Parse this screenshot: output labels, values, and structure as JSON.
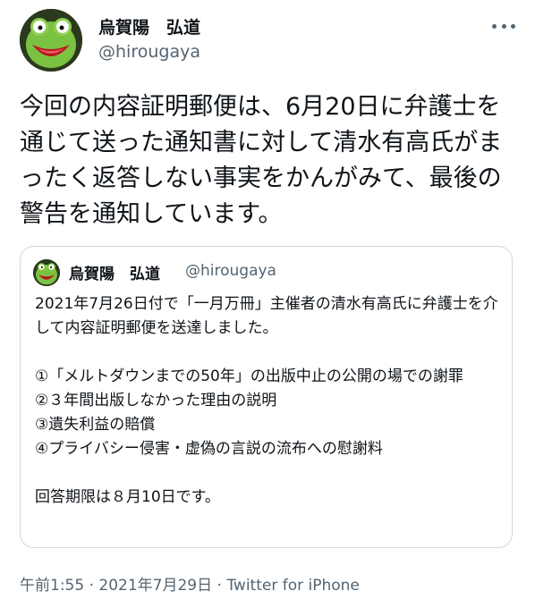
{
  "author": {
    "display_name": "烏賀陽　弘道",
    "handle": "@hirougaya"
  },
  "tweet": {
    "text": "今回の内容証明郵便は、6月20日に弁護士を通じて送った通知書に対して清水有高氏がまったく返答しない事実をかんがみて、最後の警告を通知しています。"
  },
  "quoted_tweet": {
    "display_name": "烏賀陽　弘道",
    "handle": "@hirougaya",
    "intro": "2021年7月26日付で「一月万冊」主催者の清水有高氏に弁護士を介して内容証明郵便を送達しました。",
    "items": [
      "①「メルトダウンまでの50年」の出版中止の公開の場での謝罪",
      "②３年間出版しなかった理由の説明",
      "③遺失利益の賠償",
      "④プライバシー侵害・虚偽の言説の流布への慰謝料"
    ],
    "deadline": "回答期限は８月10日です。"
  },
  "meta": {
    "time": "午前1:55",
    "separator": " · ",
    "date": "2021年7月29日",
    "source": "Twitter for iPhone"
  },
  "icons": {
    "avatar": "kermit-frog-avatar",
    "more": "more-horizontal-icon"
  }
}
